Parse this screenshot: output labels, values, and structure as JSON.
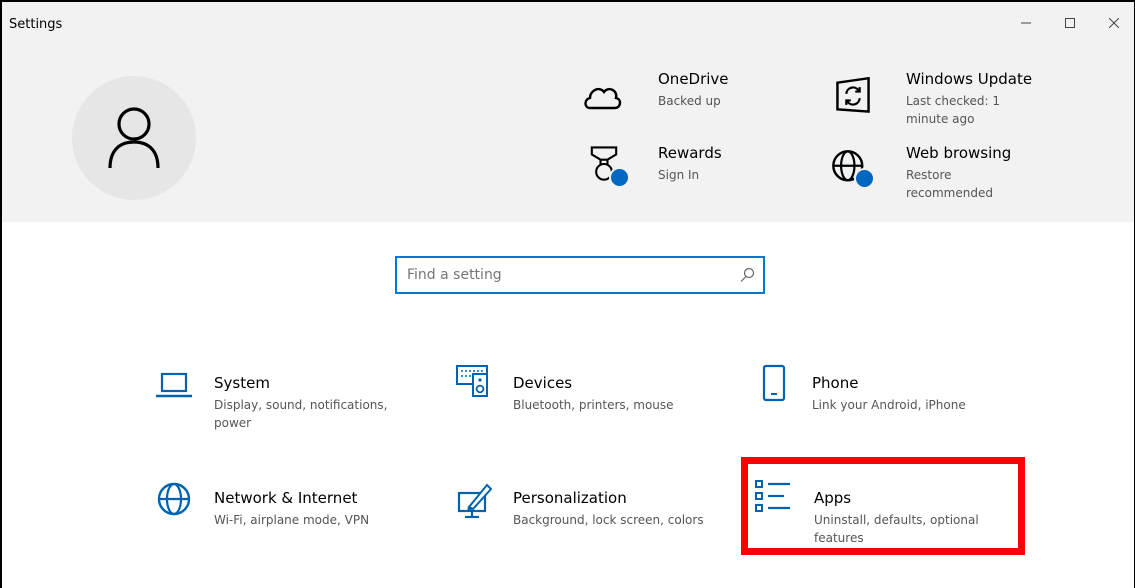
{
  "window": {
    "title": "Settings",
    "minimize_glyph": "—",
    "maximize_glyph": "□",
    "close_glyph": "✕"
  },
  "header": {
    "avatar_icon": "person-icon",
    "items": [
      {
        "id": "onedrive",
        "title": "OneDrive",
        "subtitle": "Backed up",
        "icon": "cloud-icon"
      },
      {
        "id": "windows-update",
        "title": "Windows Update",
        "subtitle": "Last checked: 1 minute ago",
        "icon": "update-icon"
      },
      {
        "id": "rewards",
        "title": "Rewards",
        "subtitle": "Sign In",
        "icon": "trophy-icon"
      },
      {
        "id": "web-browsing",
        "title": "Web browsing",
        "subtitle": "Restore recommended",
        "icon": "globe-icon"
      }
    ]
  },
  "search": {
    "placeholder": "Find a setting",
    "value": ""
  },
  "tiles": [
    {
      "title": "System",
      "subtitle": "Display, sound, notifications, power",
      "icon": "laptop-icon"
    },
    {
      "title": "Devices",
      "subtitle": "Bluetooth, printers, mouse",
      "icon": "keyboard-speaker-icon"
    },
    {
      "title": "Phone",
      "subtitle": "Link your Android, iPhone",
      "icon": "phone-icon"
    },
    {
      "title": "Network & Internet",
      "subtitle": "Wi-Fi, airplane mode, VPN",
      "icon": "globe-icon"
    },
    {
      "title": "Personalization",
      "subtitle": "Background, lock screen, colors",
      "icon": "paint-brush-icon"
    },
    {
      "title": "Apps",
      "subtitle": "Uninstall, defaults, optional features",
      "icon": "apps-list-icon"
    }
  ],
  "colors": {
    "accent": "#0078d4",
    "header_bg": "#f2f2f2",
    "badge": "#0067c0",
    "highlight": "#ff0000"
  }
}
